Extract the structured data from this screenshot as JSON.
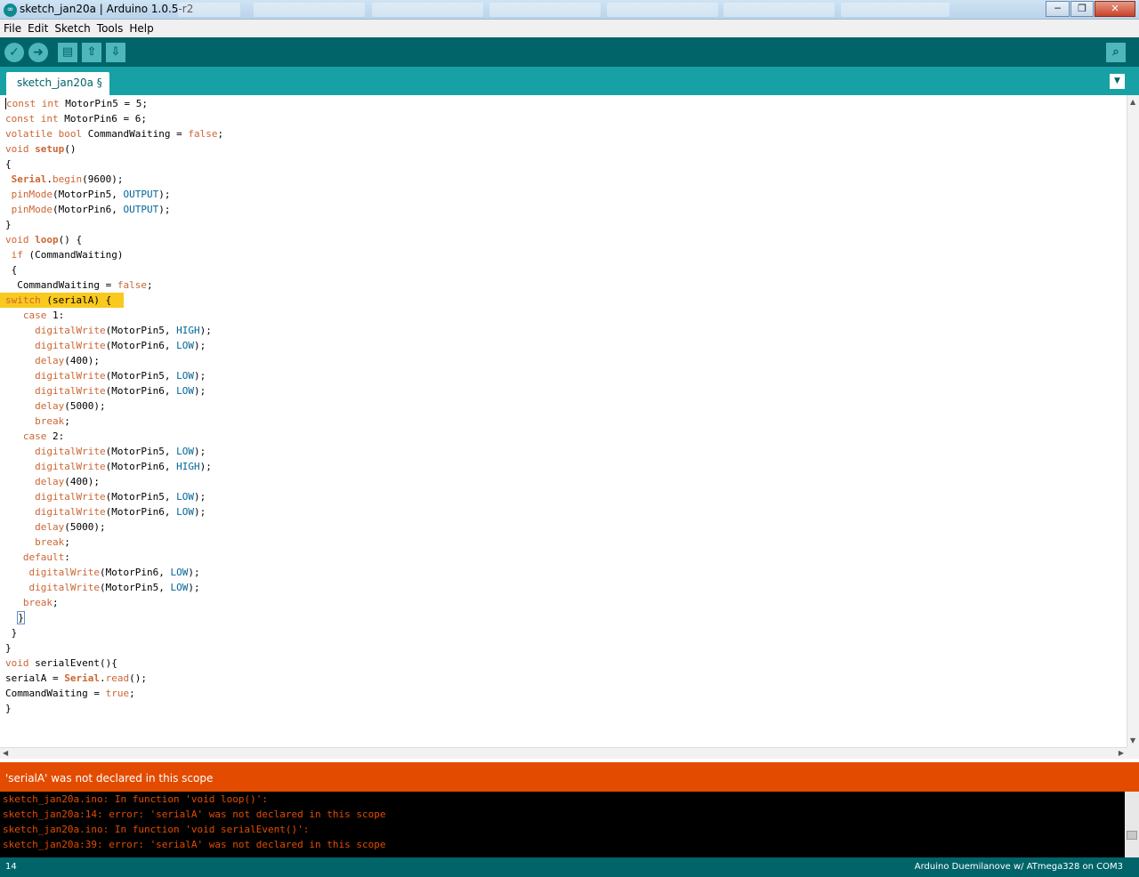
{
  "window": {
    "title": "sketch_jan20a | Arduino 1.0.5-r2",
    "minimize": "─",
    "maximize": "❐",
    "close": "✕"
  },
  "menu": [
    "File",
    "Edit",
    "Sketch",
    "Tools",
    "Help"
  ],
  "toolbar": {
    "verify_glyph": "✓",
    "upload_glyph": "➜",
    "new_glyph": "▤",
    "open_glyph": "⇧",
    "save_glyph": "⇩",
    "monitor_glyph": "⌕"
  },
  "tabs": {
    "active": "sketch_jan20a §",
    "menu_glyph": "▼"
  },
  "editor": {
    "lines": [
      "const int MotorPin5 = 5;",
      "const int MotorPin6 = 6;",
      "volatile bool CommandWaiting = false;",
      "void setup()",
      "{",
      " Serial.begin(9600);",
      " pinMode(MotorPin5, OUTPUT);",
      " pinMode(MotorPin6, OUTPUT);",
      "}",
      "void loop() {",
      " if (CommandWaiting)",
      " {",
      "  CommandWaiting = false;",
      " switch (serialA) {",
      "   case 1:",
      "     digitalWrite(MotorPin5, HIGH);",
      "     digitalWrite(MotorPin6, LOW);",
      "     delay(400);",
      "     digitalWrite(MotorPin5, LOW);",
      "     digitalWrite(MotorPin6, LOW);",
      "     delay(5000);",
      "     break;",
      "   case 2:",
      "     digitalWrite(MotorPin5, LOW);",
      "     digitalWrite(MotorPin6, HIGH);",
      "     delay(400);",
      "     digitalWrite(MotorPin5, LOW);",
      "     digitalWrite(MotorPin6, LOW);",
      "     delay(5000);",
      "     break;",
      "   default:",
      "    digitalWrite(MotorPin6, LOW);",
      "    digitalWrite(MotorPin5, LOW);",
      "   break;",
      "  }",
      " }",
      "}",
      "void serialEvent(){",
      "serialA = Serial.read();",
      "CommandWaiting = true;",
      "}"
    ],
    "highlighted_line": 14
  },
  "error_bar": {
    "message": "'serialA' was not declared in this scope"
  },
  "console": {
    "lines": [
      "sketch_jan20a.ino: In function 'void loop()':",
      "sketch_jan20a:14: error: 'serialA' was not declared in this scope",
      "sketch_jan20a.ino: In function 'void serialEvent()':",
      "sketch_jan20a:39: error: 'serialA' was not declared in this scope"
    ]
  },
  "footer": {
    "line_number": "14",
    "board": "Arduino Duemilanove w/ ATmega328 on COM3"
  },
  "colors": {
    "toolbar": "#006468",
    "tabbar": "#17a1a5",
    "highlight": "#f9c91e",
    "error_bar": "#e34c00",
    "console_text": "#e34c00",
    "keyword": "#cc6633",
    "constant": "#006699"
  }
}
